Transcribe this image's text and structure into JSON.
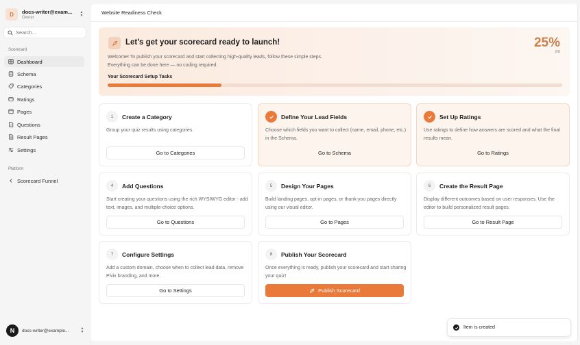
{
  "account": {
    "email": "docs-writer@exam...",
    "role": "Owner",
    "initial": "D"
  },
  "search": {
    "placeholder": "Search..."
  },
  "sidebar": {
    "group_scorecard": "Scorecard",
    "items": [
      {
        "label": "Dashboard",
        "icon": "dashboard-icon",
        "active": true
      },
      {
        "label": "Schema",
        "icon": "schema-icon"
      },
      {
        "label": "Categories",
        "icon": "categories-icon"
      },
      {
        "label": "Ratings",
        "icon": "ratings-icon"
      },
      {
        "label": "Pages",
        "icon": "pages-icon"
      },
      {
        "label": "Questions",
        "icon": "questions-icon"
      },
      {
        "label": "Result Pages",
        "icon": "result-pages-icon"
      },
      {
        "label": "Settings",
        "icon": "settings-icon"
      }
    ],
    "group_platform": "Platform",
    "platform_items": [
      {
        "label": "Scorecard Funnel",
        "icon": "chevron-left-icon"
      }
    ]
  },
  "footer": {
    "email": "docs-writer@example...",
    "logo": "N"
  },
  "header": {
    "title": "Website Readiness Check"
  },
  "hero": {
    "title": "Let’s get your scorecard ready to launch!",
    "description": "Welcome! To publish your scorecard and start collecting high-quality leads, follow these simple steps. Everything can be done here — no coding required.",
    "percent": "25%",
    "count": "2/8",
    "progress": 0.25,
    "tasks_label": "Your Scorecard Setup Tasks"
  },
  "cards": [
    {
      "num": "1",
      "title": "Create a Category",
      "desc": "Group your quiz results using categories.",
      "button": "Go to Categories",
      "done": false
    },
    {
      "num": "2",
      "title": "Define Your Lead Fields",
      "desc": "Choose which fields you want to collect (name, email, phone, etc.) in the Schema.",
      "button": "Go to Schema",
      "done": true
    },
    {
      "num": "3",
      "title": "Set Up Ratings",
      "desc": "Use ratings to define how answers are scored and what the final results mean.",
      "button": "Go to Ratings",
      "done": true
    },
    {
      "num": "4",
      "title": "Add Questions",
      "desc": "Start creating your questions using the rich WYSIWYG editor - add text, images, and multiple-choice options.",
      "button": "Go to Questions",
      "done": false
    },
    {
      "num": "5",
      "title": "Design Your Pages",
      "desc": "Build landing pages, opt-in pages, or thank-you pages directly using our visual editor.",
      "button": "Go to Pages",
      "done": false
    },
    {
      "num": "6",
      "title": "Create the Result Page",
      "desc": "Display different outcomes based on user responses. Use the editor to build personalized result pages.",
      "button": "Go to Result Page",
      "done": false
    },
    {
      "num": "7",
      "title": "Configure Settings",
      "desc": "Add a custom domain, choose when to collect lead data, remove Pivix branding, and more.",
      "button": "Go to Settings",
      "done": false
    },
    {
      "num": "8",
      "title": "Publish Your Scorecard",
      "desc": "Once everything is ready, publish your scorecard and start sharing your quiz!",
      "button": "Publish Scorecard",
      "done": false,
      "primary": true
    }
  ],
  "toast": {
    "text": "Item is created"
  },
  "colors": {
    "accent": "#e97a3a",
    "accent_light": "#fdf4ee",
    "percent": "#c9824d"
  }
}
